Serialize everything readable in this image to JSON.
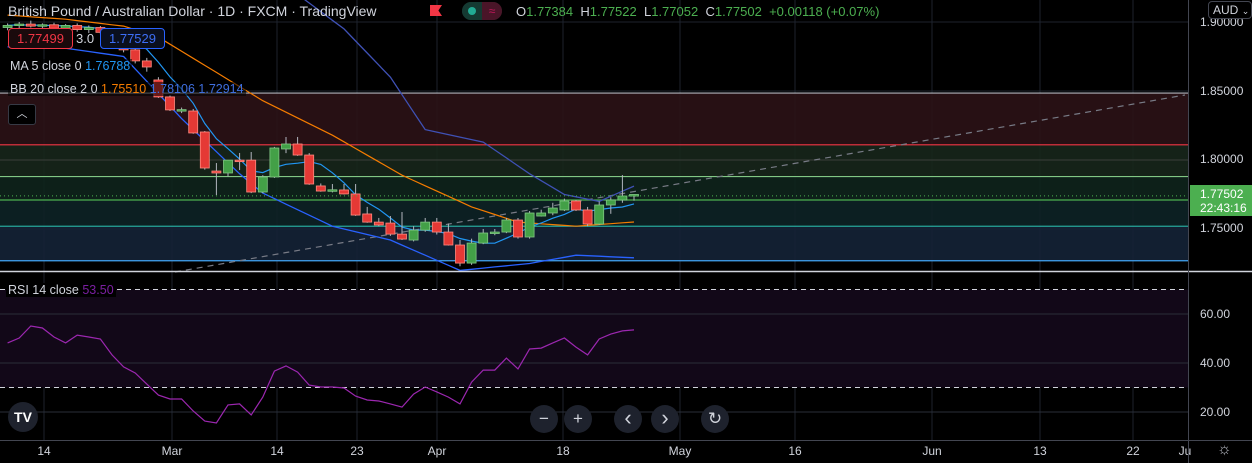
{
  "header": {
    "title": "British Pound / Australian Dollar · 1D · FXCM · TradingView",
    "flag_icon": "flag-icon",
    "toggle_icons": [
      "dot-icon",
      "wave-icon"
    ],
    "ohlc": {
      "o_label": "O",
      "o": "1.77384",
      "h_label": "H",
      "h": "1.77522",
      "l_label": "L",
      "l": "1.77052",
      "c_label": "C",
      "c": "1.77502",
      "change": "+0.00118 (+0.07%)"
    }
  },
  "trade": {
    "bid": "1.77499",
    "spread": "3.0",
    "ask": "1.77529"
  },
  "legend": {
    "ma_label": "MA 5 close 0",
    "ma_value": "1.76788",
    "bb_label": "BB 20 close 2 0",
    "bb_basis": "1.75510",
    "bb_upper": "1.78106",
    "bb_lower": "1.72914",
    "rsi_label": "RSI 14 close",
    "rsi_value": "53.50"
  },
  "price_axis": {
    "currency": "AUD",
    "ticks": [
      "1.90000",
      "1.85000",
      "1.80000",
      "1.75000"
    ],
    "current_price": "1.77502",
    "countdown": "22:43:16",
    "rsi_ticks": [
      "60.00",
      "40.00",
      "20.00"
    ]
  },
  "time_axis": [
    "14",
    "Mar",
    "14",
    "23",
    "Apr",
    "18",
    "May",
    "16",
    "Jun",
    "13",
    "22",
    "Ju"
  ],
  "controls": {
    "zoom_out": "−",
    "zoom_in": "+",
    "scroll_left": "‹",
    "scroll_right": "›",
    "reset": "↻",
    "logo": "TV"
  },
  "colors": {
    "up": "#43a047",
    "down": "#e53935",
    "ma": "#2196f3",
    "bb_basis": "#f57c00",
    "bb_band": "#3f51b5",
    "rsi": "#9c27b0",
    "current": "#4caf50"
  },
  "chart_data": {
    "type": "candlestick",
    "title": "British Pound / Australian Dollar · 1D · FXCM",
    "ylim": [
      1.715,
      1.915
    ],
    "rsi_ylim": [
      0,
      100
    ],
    "ohlc": [
      [
        1.896,
        1.899,
        1.894,
        1.8975
      ],
      [
        1.8975,
        1.9,
        1.895,
        1.8985
      ],
      [
        1.8985,
        1.901,
        1.896,
        1.897
      ],
      [
        1.897,
        1.899,
        1.895,
        1.898
      ],
      [
        1.898,
        1.8995,
        1.8945,
        1.8955
      ],
      [
        1.8955,
        1.8985,
        1.894,
        1.8975
      ],
      [
        1.8975,
        1.899,
        1.893,
        1.8945
      ],
      [
        1.8945,
        1.8975,
        1.892,
        1.896
      ],
      [
        1.896,
        1.897,
        1.891,
        1.8925
      ],
      [
        1.8925,
        1.894,
        1.888,
        1.8895
      ],
      [
        1.8895,
        1.892,
        1.878,
        1.8798
      ],
      [
        1.8798,
        1.883,
        1.87,
        1.8718
      ],
      [
        1.8718,
        1.874,
        1.864,
        1.8674
      ],
      [
        1.858,
        1.86,
        1.845,
        1.8457
      ],
      [
        1.8457,
        1.8471,
        1.8355,
        1.8363
      ],
      [
        1.836,
        1.838,
        1.834,
        1.8365
      ],
      [
        1.8355,
        1.837,
        1.819,
        1.8196
      ],
      [
        1.8203,
        1.821,
        1.793,
        1.7942
      ],
      [
        1.792,
        1.7978,
        1.7746,
        1.7906
      ],
      [
        1.7906,
        1.7995,
        1.788,
        1.7999
      ],
      [
        1.7999,
        1.8051,
        1.7927,
        1.7995
      ],
      [
        1.7999,
        1.8058,
        1.776,
        1.7768
      ],
      [
        1.7768,
        1.789,
        1.776,
        1.7877
      ],
      [
        1.7877,
        1.8095,
        1.787,
        1.8087
      ],
      [
        1.808,
        1.8167,
        1.805,
        1.8116
      ],
      [
        1.8116,
        1.8167,
        1.803,
        1.8036
      ],
      [
        1.8036,
        1.805,
        1.782,
        1.7826
      ],
      [
        1.7812,
        1.783,
        1.777,
        1.7775
      ],
      [
        1.778,
        1.7826,
        1.7765,
        1.7784
      ],
      [
        1.7783,
        1.7826,
        1.775,
        1.7754
      ],
      [
        1.7754,
        1.7826,
        1.7595,
        1.7601
      ],
      [
        1.7609,
        1.766,
        1.7545,
        1.755
      ],
      [
        1.755,
        1.758,
        1.752,
        1.7529
      ],
      [
        1.7543,
        1.7594,
        1.745,
        1.7463
      ],
      [
        1.7463,
        1.7623,
        1.742,
        1.7427
      ],
      [
        1.742,
        1.752,
        1.741,
        1.7492
      ],
      [
        1.7492,
        1.758,
        1.748,
        1.755
      ],
      [
        1.755,
        1.758,
        1.746,
        1.7478
      ],
      [
        1.7478,
        1.754,
        1.738,
        1.7384
      ],
      [
        1.7384,
        1.742,
        1.723,
        1.7253
      ],
      [
        1.7253,
        1.743,
        1.724,
        1.7398
      ],
      [
        1.7398,
        1.75,
        1.739,
        1.7471
      ],
      [
        1.7475,
        1.75,
        1.7455,
        1.7478
      ],
      [
        1.7478,
        1.758,
        1.747,
        1.7565
      ],
      [
        1.7565,
        1.758,
        1.743,
        1.7442
      ],
      [
        1.7442,
        1.763,
        1.743,
        1.7616
      ],
      [
        1.7594,
        1.764,
        1.759,
        1.7616
      ],
      [
        1.7616,
        1.769,
        1.76,
        1.7652
      ],
      [
        1.7638,
        1.772,
        1.763,
        1.7703
      ],
      [
        1.7703,
        1.771,
        1.763,
        1.7638
      ],
      [
        1.7638,
        1.766,
        1.752,
        1.7536
      ],
      [
        1.7536,
        1.77,
        1.753,
        1.7674
      ],
      [
        1.7674,
        1.773,
        1.761,
        1.771
      ],
      [
        1.771,
        1.7891,
        1.769,
        1.7739
      ],
      [
        1.77384,
        1.77522,
        1.77052,
        1.77502
      ]
    ],
    "bb_upper": [
      [
        0,
        1.95
      ],
      [
        20,
        1.935
      ],
      [
        25,
        1.92
      ],
      [
        29,
        1.895
      ],
      [
        33,
        1.86
      ],
      [
        36,
        1.822
      ],
      [
        41,
        1.813
      ],
      [
        45,
        1.79
      ],
      [
        48,
        1.775
      ],
      [
        51,
        1.77
      ],
      [
        54,
        1.78106
      ]
    ],
    "bb_basis": [
      [
        0,
        1.905
      ],
      [
        5,
        1.902
      ],
      [
        10,
        1.897
      ],
      [
        13,
        1.889
      ],
      [
        22,
        1.843
      ],
      [
        28,
        1.818
      ],
      [
        34,
        1.789
      ],
      [
        40,
        1.766
      ],
      [
        44,
        1.755
      ],
      [
        49,
        1.752
      ],
      [
        54,
        1.7551
      ]
    ],
    "bb_lower": [
      [
        0,
        1.882
      ],
      [
        5,
        1.881
      ],
      [
        10,
        1.875
      ],
      [
        15,
        1.83
      ],
      [
        20,
        1.79
      ],
      [
        22,
        1.776
      ],
      [
        28,
        1.752
      ],
      [
        33,
        1.742
      ],
      [
        39,
        1.72
      ],
      [
        45,
        1.725
      ],
      [
        49,
        1.731
      ],
      [
        54,
        1.72914
      ]
    ],
    "rsi": [
      48.2,
      50.2,
      55.1,
      54.3,
      50.6,
      48.2,
      51.4,
      50.6,
      49.8,
      43.3,
      38.4,
      35.9,
      31.4,
      26.9,
      25.3,
      25.3,
      20.4,
      16.3,
      15.5,
      22.9,
      23.3,
      18.8,
      26.1,
      36.7,
      38.8,
      36.3,
      31.0,
      30.2,
      30.2,
      29.8,
      26.5,
      24.9,
      24.5,
      23.3,
      22.0,
      27.3,
      30.2,
      28.2,
      26.1,
      23.3,
      32.2,
      37.1,
      37.1,
      42.0,
      37.6,
      45.7,
      46.1,
      48.2,
      50.2,
      46.5,
      43.3,
      49.8,
      51.8,
      53.1,
      53.5
    ],
    "rsi_levels": [
      70,
      30
    ],
    "horizontal_levels": [
      1.8485,
      1.811,
      1.788,
      1.771,
      1.752,
      1.727
    ]
  }
}
